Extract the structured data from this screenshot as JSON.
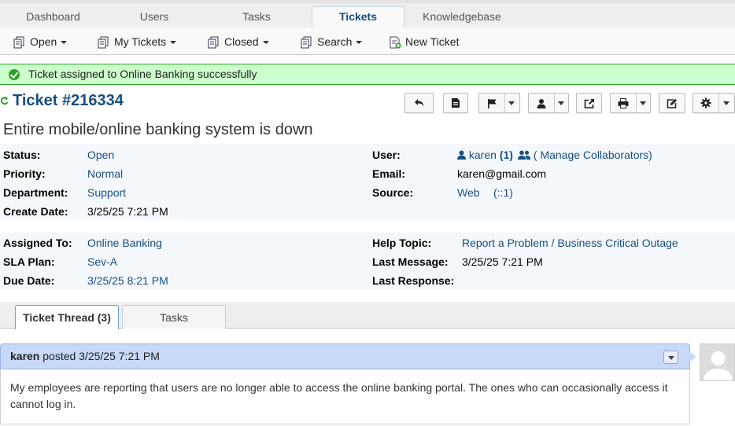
{
  "topnav": {
    "tabs": [
      {
        "label": "Dashboard"
      },
      {
        "label": "Users"
      },
      {
        "label": "Tasks"
      },
      {
        "label": "Tickets"
      },
      {
        "label": "Knowledgebase"
      }
    ],
    "active": "Tickets"
  },
  "subnav": {
    "open": "Open",
    "my_tickets": "My Tickets",
    "closed": "Closed",
    "search": "Search",
    "new_ticket": "New Ticket"
  },
  "notice": {
    "message": "Ticket assigned to Online Banking successfully",
    "color": "#2ea12e"
  },
  "ticket": {
    "title": "Ticket #216334",
    "subject": "Entire mobile/online banking system is down"
  },
  "toolbar_icons": [
    "reply-icon",
    "note-icon",
    "flag-icon",
    "user-icon",
    "share-icon",
    "print-icon",
    "edit-icon",
    "gear-icon"
  ],
  "info1": {
    "status_label": "Status:",
    "status": "Open",
    "priority_label": "Priority:",
    "priority": "Normal",
    "department_label": "Department:",
    "department": "Support",
    "create_date_label": "Create Date:",
    "create_date": "3/25/25 7:21 PM",
    "user_label": "User:",
    "user": "karen",
    "user_count": "(1)",
    "collaborators": "( Manage Collaborators)",
    "email_label": "Email:",
    "email": "karen@gmail.com",
    "source_label": "Source:",
    "source": "Web",
    "source_ip": "(::1)"
  },
  "info2": {
    "assigned_label": "Assigned To:",
    "assigned": "Online Banking",
    "sla_label": "SLA Plan:",
    "sla": "Sev-A",
    "due_label": "Due Date:",
    "due": "3/25/25 8:21 PM",
    "help_topic_label": "Help Topic:",
    "help_topic": "Report a Problem / Business Critical Outage",
    "last_message_label": "Last Message:",
    "last_message": "3/25/25 7:21 PM",
    "last_response_label": "Last Response:",
    "last_response": ""
  },
  "thread_tabs": {
    "thread": "Ticket Thread (3)",
    "tasks": "Tasks"
  },
  "entry": {
    "author": "karen",
    "posted": "posted 3/25/25 7:21 PM",
    "body": "My employees are reporting that users are no longer able to access the online banking portal. The ones who can occasionally access it cannot log in."
  },
  "colors": {
    "brand": "#184e81",
    "entry_header": "#c8d8f7",
    "info_bg": "#f4f8fc"
  }
}
